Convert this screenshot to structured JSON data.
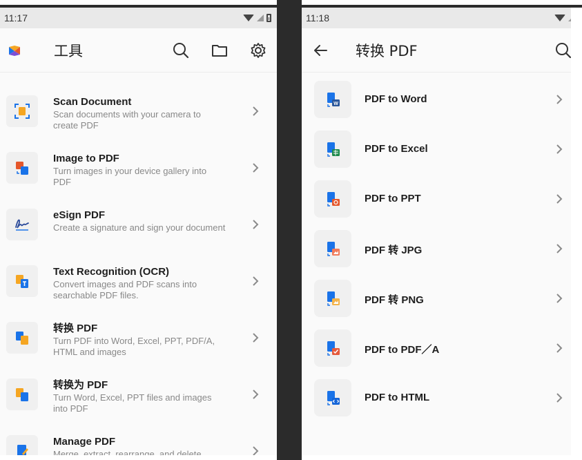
{
  "left": {
    "status_time": "11:17",
    "title": "工具",
    "items": [
      {
        "title": "Scan Document",
        "desc": "Scan documents with your camera to create PDF"
      },
      {
        "title": "Image to PDF",
        "desc": "Turn images in your device gallery into PDF"
      },
      {
        "title": "eSign PDF",
        "desc": "Create a signature and sign your document"
      },
      {
        "title": "Text Recognition (OCR)",
        "desc": "Convert images and PDF scans into searchable PDF files."
      },
      {
        "title": "转换 PDF",
        "desc": "Turn PDF into Word, Excel, PPT, PDF/A, HTML and images"
      },
      {
        "title": "转换为 PDF",
        "desc": "Turn Word, Excel, PPT files and images into PDF"
      },
      {
        "title": "Manage PDF",
        "desc": "Merge, extract, rearrange, and delete pages within your PDF"
      }
    ]
  },
  "right": {
    "status_time": "11:18",
    "title": "转换 PDF",
    "items": [
      {
        "label": "PDF to Word",
        "badge_color": "#2b579a"
      },
      {
        "label": "PDF to Excel",
        "badge_color": "#1e8a4c"
      },
      {
        "label": "PDF to PPT",
        "badge_color": "#e5572b"
      },
      {
        "label": "PDF 转 JPG",
        "badge_color": "#f07a5a"
      },
      {
        "label": "PDF 转 PNG",
        "badge_color": "#f3b34a"
      },
      {
        "label": "PDF to PDF／A",
        "badge_color": "#e55a3c"
      },
      {
        "label": "PDF to HTML",
        "badge_color": "#1a73e8"
      }
    ]
  },
  "colors": {
    "blue": "#1a73e8",
    "orange": "#f5a623",
    "chevron": "#8a8a8a"
  },
  "icons": [
    "search-icon",
    "folder-icon",
    "gear-icon",
    "back-arrow-icon",
    "chevron-right-icon"
  ]
}
